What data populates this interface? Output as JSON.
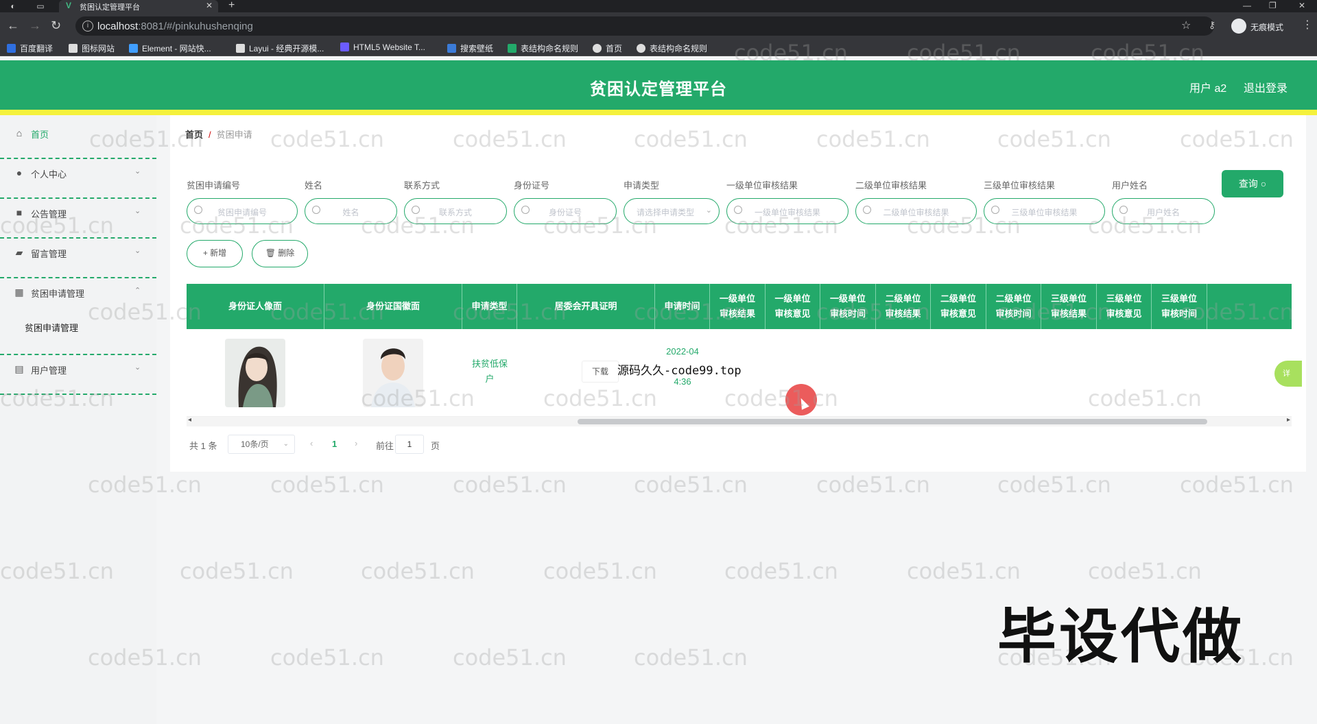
{
  "browser": {
    "tab_title": "贫困认定管理平台",
    "url_host": "localhost",
    "url_rest": ":8081/#/pinkuhushenqing",
    "profile_label": "无痕模式",
    "bookmarks": [
      {
        "label": "百度翻译",
        "color": "#2f6fe0"
      },
      {
        "label": "图标网站",
        "color": "#ffffff"
      },
      {
        "label": "Element - 网站快...",
        "color": "#409eff"
      },
      {
        "label": "Layui - 经典开源模...",
        "color": "#ffffff"
      },
      {
        "label": "HTML5 Website T...",
        "color": "#6b5cff"
      },
      {
        "label": "搜索壁纸",
        "color": "#3b7bd8"
      },
      {
        "label": "表结构命名规则",
        "color": "#23a96a"
      },
      {
        "label": "首页",
        "color": "#ffffff"
      },
      {
        "label": "表结构命名规则",
        "color": "#ffffff"
      }
    ]
  },
  "header": {
    "title": "贫困认定管理平台",
    "user_label": "用户 a2",
    "logout_label": "退出登录"
  },
  "sidebar": {
    "items": [
      {
        "label": "首页",
        "icon": "home-icon",
        "glyph": "⌂",
        "chevron": ""
      },
      {
        "label": "个人中心",
        "icon": "user-icon",
        "glyph": "●",
        "chevron": "⌄"
      },
      {
        "label": "公告管理",
        "icon": "notice-icon",
        "glyph": "■",
        "chevron": "⌄"
      },
      {
        "label": "留言管理",
        "icon": "message-icon",
        "glyph": "▰",
        "chevron": "⌄"
      },
      {
        "label": "贫困申请管理",
        "icon": "grid-icon",
        "glyph": "▦",
        "chevron": "⌃"
      },
      {
        "label": "用户管理",
        "icon": "list-icon",
        "glyph": "▤",
        "chevron": "⌄"
      }
    ],
    "sub_item": "贫困申请管理"
  },
  "breadcrumb": {
    "home": "首页",
    "separator": "/",
    "current": "贫困申请"
  },
  "filters": [
    {
      "label": "贫困申请编号",
      "placeholder": "贫困申请编号"
    },
    {
      "label": "姓名",
      "placeholder": "姓名"
    },
    {
      "label": "联系方式",
      "placeholder": "联系方式"
    },
    {
      "label": "身份证号",
      "placeholder": "身份证号"
    },
    {
      "label": "申请类型",
      "placeholder": "请选择申请类型"
    },
    {
      "label": "一级单位审核结果",
      "placeholder": "一级单位审核结果"
    },
    {
      "label": "二级单位审核结果",
      "placeholder": "二级单位审核结果"
    },
    {
      "label": "三级单位审核结果",
      "placeholder": "三级单位审核结果"
    },
    {
      "label": "用户姓名",
      "placeholder": "用户姓名"
    }
  ],
  "actions": {
    "query": "查询 ○",
    "add": "+ 新增",
    "delete": "🗑 删除"
  },
  "table": {
    "headers": [
      "身份证人像面",
      "身份证国徽面",
      "申请类型",
      "居委会开具证明",
      "申请时间",
      "一级单位\n审核结果",
      "一级单位\n审核意见",
      "一级单位\n审核时间",
      "二级单位\n审核结果",
      "二级单位\n审核意见",
      "二级单位\n审核时间",
      "三级单位\n审核结果",
      "三级单位\n审核意见",
      "三级单位\n审核时间"
    ],
    "row": {
      "type": "扶贫低保\n户",
      "download": "下载",
      "time_line1": "2022-04",
      "time_line3": "4:36",
      "detail": "详"
    }
  },
  "overlay_text": "源码久久-code99.top",
  "pagination": {
    "total": "共 1 条",
    "page_size": "10条/页",
    "prev": "‹",
    "current": "1",
    "next": "›",
    "goto_label": "前往",
    "goto_value": "1",
    "page_label": "页"
  },
  "watermark": "code51.cn",
  "promo_text": "毕设代做",
  "colors": {
    "brand": "#23a96a",
    "accent_yellow": "#f5f13c",
    "light_green": "#a8e05e"
  }
}
